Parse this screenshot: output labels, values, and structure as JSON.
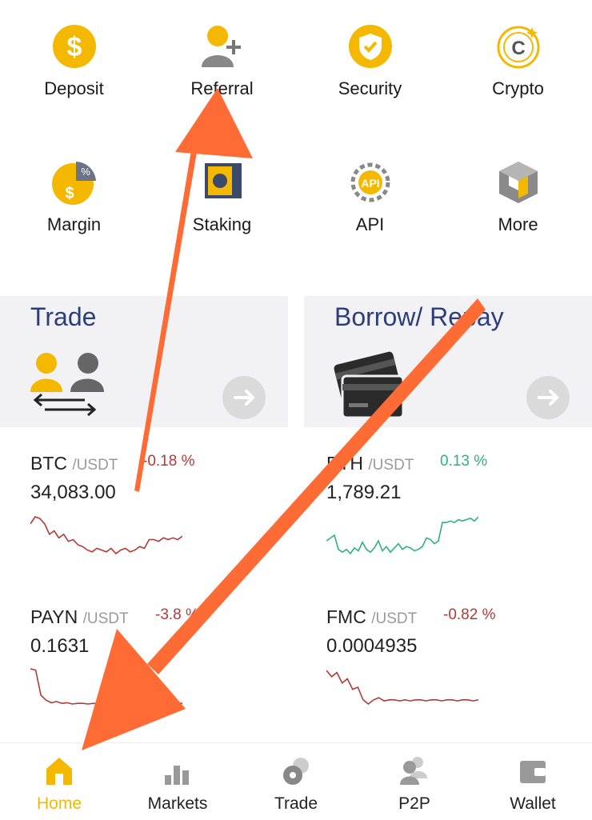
{
  "shortcuts": [
    {
      "label": "Deposit",
      "icon": "dollar-coin-icon"
    },
    {
      "label": "Referral",
      "icon": "add-user-icon"
    },
    {
      "label": "Security",
      "icon": "shield-check-icon"
    },
    {
      "label": "Crypto",
      "icon": "crypto-coin-icon"
    },
    {
      "label": "Margin",
      "icon": "margin-pie-icon"
    },
    {
      "label": "Staking",
      "icon": "staking-icon"
    },
    {
      "label": "API",
      "icon": "api-gear-icon"
    },
    {
      "label": "More",
      "icon": "cubes-icon"
    }
  ],
  "cards": {
    "trade": {
      "title": "Trade",
      "icon": "traders-exchange-icon"
    },
    "borrow": {
      "title": "Borrow/ Repay",
      "icon": "credit-cards-icon"
    }
  },
  "tickers": [
    {
      "base": "BTC",
      "quote": "/USDT",
      "change": "-0.18 %",
      "price": "34,083.00",
      "direction": "down",
      "series": [
        30,
        34,
        33,
        30,
        24,
        26,
        22,
        24,
        20,
        21,
        18,
        17,
        15,
        14,
        16,
        15,
        14,
        16,
        13,
        15,
        16,
        14,
        15,
        17,
        16,
        21,
        21,
        20,
        22,
        21,
        22,
        21,
        23
      ]
    },
    {
      "base": "ETH",
      "quote": "/USDT",
      "change": "0.13 %",
      "price": "1,789.21",
      "direction": "up",
      "series": [
        14,
        16,
        18,
        8,
        6,
        8,
        5,
        9,
        7,
        13,
        8,
        6,
        9,
        14,
        7,
        10,
        6,
        9,
        12,
        8,
        10,
        9,
        7,
        8,
        10,
        16,
        15,
        12,
        14,
        27,
        27,
        28,
        27,
        29,
        28,
        29,
        30,
        28,
        31
      ]
    },
    {
      "base": "PAYN",
      "quote": "/USDT",
      "change": "-3.8 %",
      "price": "0.1631",
      "direction": "down",
      "series": [
        60,
        58,
        18,
        10,
        6,
        8,
        5,
        6,
        4,
        5,
        5,
        4,
        5,
        4,
        5,
        5,
        4,
        5,
        5,
        4,
        5,
        5,
        5,
        4,
        5,
        5,
        5,
        4,
        5,
        5
      ]
    },
    {
      "base": "FMC",
      "quote": "/USDT",
      "change": "-0.82 %",
      "price": "0.0004935",
      "direction": "down",
      "series": [
        42,
        36,
        40,
        30,
        34,
        24,
        26,
        14,
        10,
        14,
        16,
        13,
        14,
        14,
        13,
        14,
        13,
        14,
        14,
        13,
        14,
        14,
        13,
        14,
        14,
        13,
        14,
        14,
        13,
        14
      ]
    }
  ],
  "nav": [
    {
      "label": "Home",
      "icon": "home-icon",
      "active": true
    },
    {
      "label": "Markets",
      "icon": "bar-chart-icon",
      "active": false
    },
    {
      "label": "Trade",
      "icon": "coins-icon",
      "active": false
    },
    {
      "label": "P2P",
      "icon": "users-icon",
      "active": false
    },
    {
      "label": "Wallet",
      "icon": "wallet-icon",
      "active": false
    }
  ],
  "colors": {
    "accent": "#f5b800",
    "up": "#2db37c",
    "down": "#b23a36",
    "annotation": "#ff6b35"
  }
}
